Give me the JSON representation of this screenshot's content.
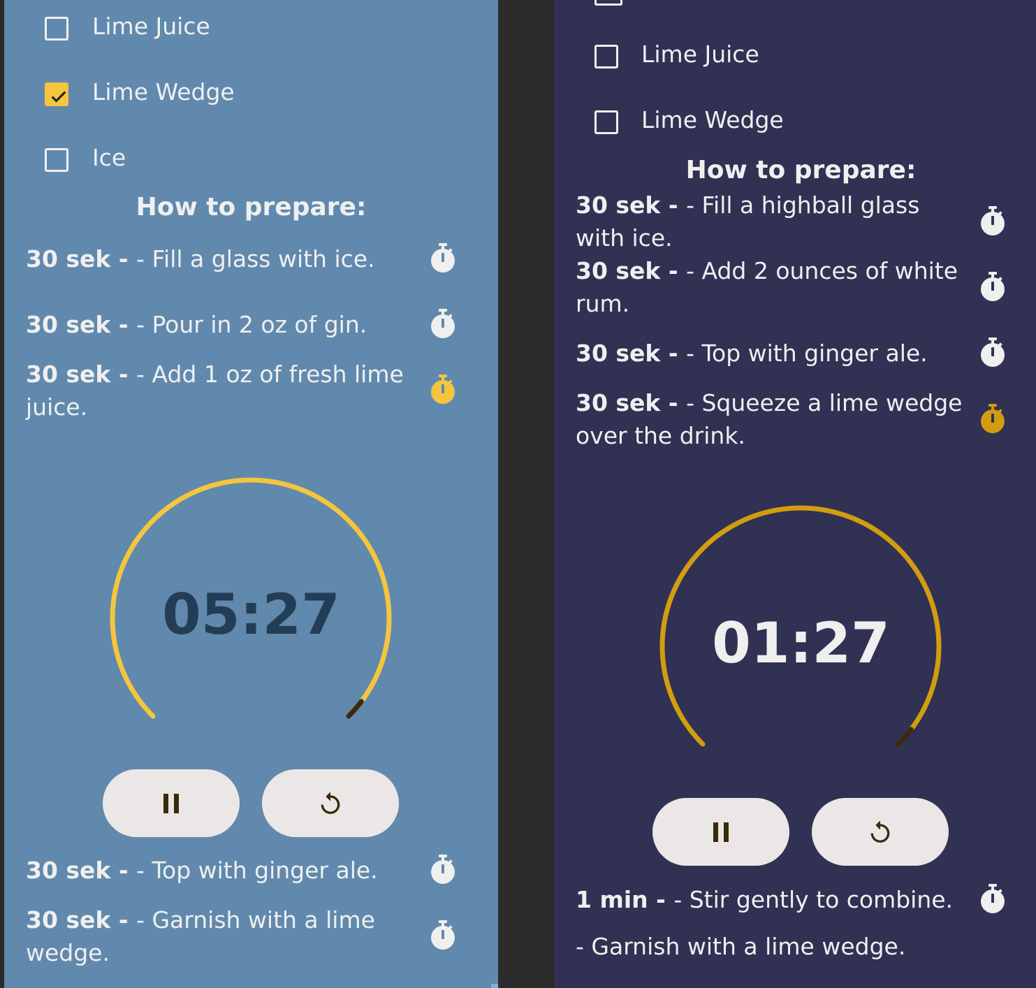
{
  "colors": {
    "left_background": "#6089ad",
    "right_background": "#303153",
    "gutter": "#2b2b2b",
    "left_accent": "#f5c53e",
    "right_accent": "#d29d0f",
    "left_timer_text": "#233d56",
    "right_timer_text": "#f0efef",
    "button_background": "#ebe7e6",
    "button_icon": "#3b2a0a",
    "text": "#f0efef"
  },
  "left": {
    "ingredients": [
      {
        "label": "Lime Juice",
        "checked": false
      },
      {
        "label": "Lime Wedge",
        "checked": true
      },
      {
        "label": "Ice",
        "checked": false
      }
    ],
    "section_title": "How to prepare:",
    "steps_top": [
      {
        "duration": "30 sek - ",
        "text": " - Fill a glass with ice.",
        "timer_icon": "stopwatch-icon",
        "active": false
      },
      {
        "duration": "30 sek - ",
        "text": " - Pour in 2 oz of gin.",
        "timer_icon": "stopwatch-icon",
        "active": false
      },
      {
        "duration": "30 sek - ",
        "text": " - Add 1 oz of fresh lime juice.",
        "timer_icon": "stopwatch-icon",
        "active": true
      }
    ],
    "timer": {
      "display": "05:27",
      "progress": 0.97
    },
    "buttons": {
      "pause_icon": "pause-icon",
      "reset_icon": "restart-icon"
    },
    "steps_bottom": [
      {
        "duration": "30 sek - ",
        "text": " - Top with ginger ale.",
        "timer_icon": "stopwatch-icon",
        "active": false
      },
      {
        "duration": "30 sek - ",
        "text": " - Garnish with a lime wedge.",
        "timer_icon": "stopwatch-icon",
        "active": false
      }
    ]
  },
  "right": {
    "ingredients": [
      {
        "label": "Lime Juice",
        "checked": false
      },
      {
        "label": "Lime Wedge",
        "checked": false
      }
    ],
    "section_title": "How to prepare:",
    "steps_top": [
      {
        "duration": "30 sek - ",
        "text": " - Fill a highball glass with ice.",
        "timer_icon": "stopwatch-icon",
        "active": false
      },
      {
        "duration": "30 sek - ",
        "text": " - Add 2 ounces of white rum.",
        "timer_icon": "stopwatch-icon",
        "active": false
      },
      {
        "duration": "30 sek - ",
        "text": " - Top with ginger ale.",
        "timer_icon": "stopwatch-icon",
        "active": false
      },
      {
        "duration": "30 sek - ",
        "text": " - Squeeze a lime wedge over the drink.",
        "timer_icon": "stopwatch-icon",
        "active": true
      }
    ],
    "timer": {
      "display": "01:27",
      "progress": 0.97
    },
    "buttons": {
      "pause_icon": "pause-icon",
      "reset_icon": "restart-icon"
    },
    "steps_bottom": [
      {
        "duration": "1 min - ",
        "text": " - Stir gently to combine.",
        "timer_icon": "stopwatch-icon",
        "active": false
      }
    ],
    "trailing_note": " - Garnish with a lime wedge."
  }
}
